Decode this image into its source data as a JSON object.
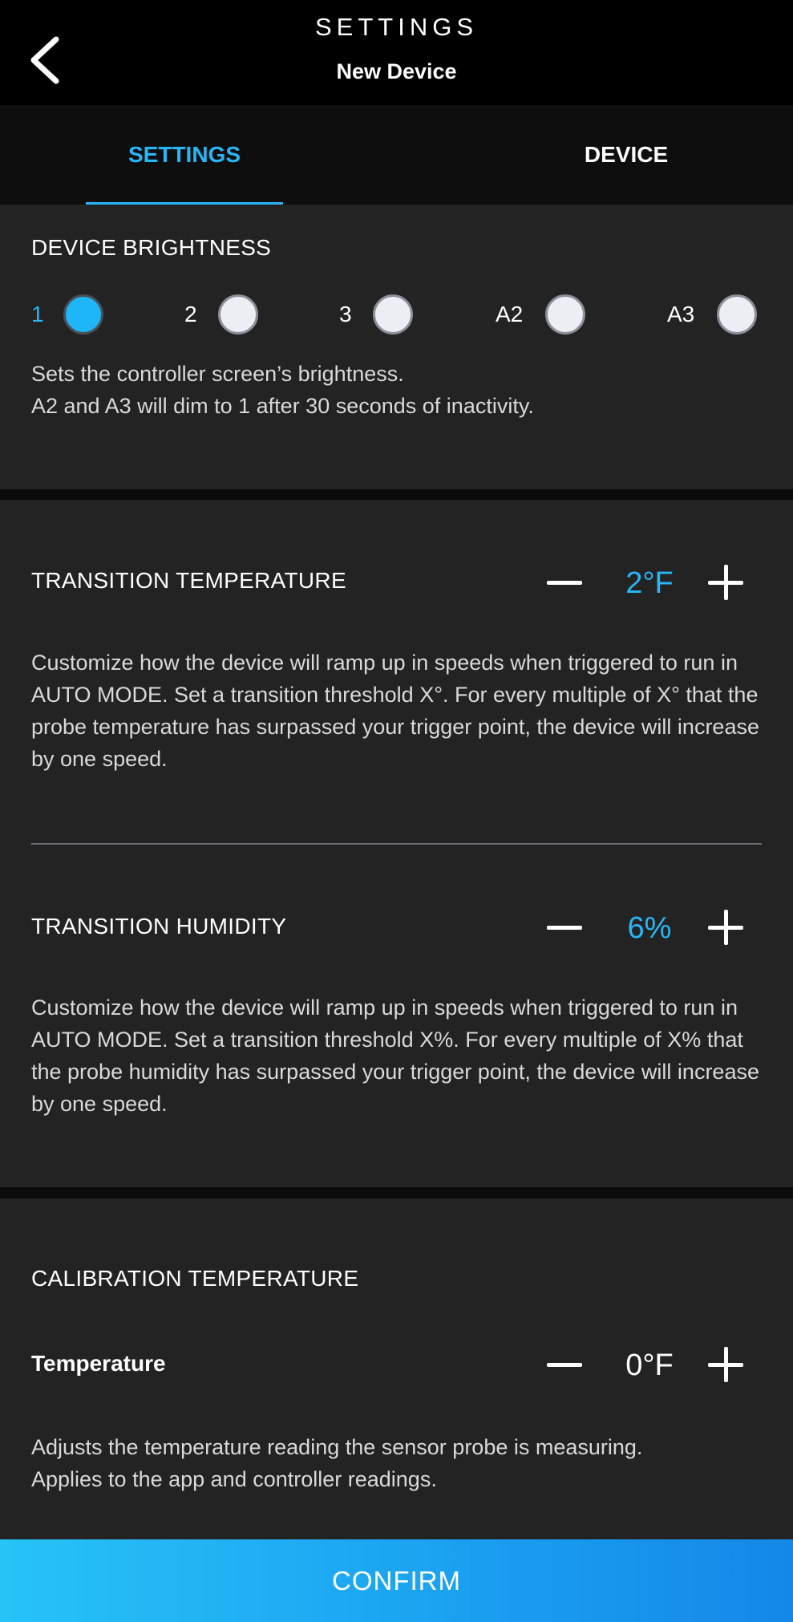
{
  "header": {
    "title": "SETTINGS",
    "subtitle": "New Device"
  },
  "tabs": [
    {
      "label": "SETTINGS",
      "active": true
    },
    {
      "label": "DEVICE",
      "active": false
    }
  ],
  "brightness": {
    "title": "DEVICE BRIGHTNESS",
    "options": [
      {
        "label": "1",
        "selected": true
      },
      {
        "label": "2",
        "selected": false
      },
      {
        "label": "3",
        "selected": false
      },
      {
        "label": "A2",
        "selected": false
      },
      {
        "label": "A3",
        "selected": false
      }
    ],
    "desc_line1": "Sets the controller screen’s brightness.",
    "desc_line2": "A2 and A3 will dim to 1 after 30 seconds of inactivity."
  },
  "transition_temperature": {
    "title": "TRANSITION TEMPERATURE",
    "value": "2°F",
    "description": "Customize how the device will ramp up in speeds when triggered to run in AUTO MODE. Set a transition threshold X°. For every multiple of X° that the probe temperature has surpassed your trigger point, the device will increase by one speed."
  },
  "transition_humidity": {
    "title": "TRANSITION HUMIDITY",
    "value": "6%",
    "description": "Customize how the device will ramp up in speeds when triggered to run in AUTO MODE. Set a transition threshold X%. For every multiple of X% that the probe humidity has surpassed your trigger point, the device will increase by one speed."
  },
  "calibration": {
    "title": "CALIBRATION TEMPERATURE",
    "label": "Temperature",
    "value": "0°F",
    "desc_line1": "Adjusts the temperature reading the sensor probe is measuring.",
    "desc_line2": "Applies to the app and controller readings."
  },
  "confirm_label": "CONFIRM",
  "colors": {
    "accent": "#29b6f6",
    "panel": "#232324",
    "background": "#0b0b0c"
  }
}
